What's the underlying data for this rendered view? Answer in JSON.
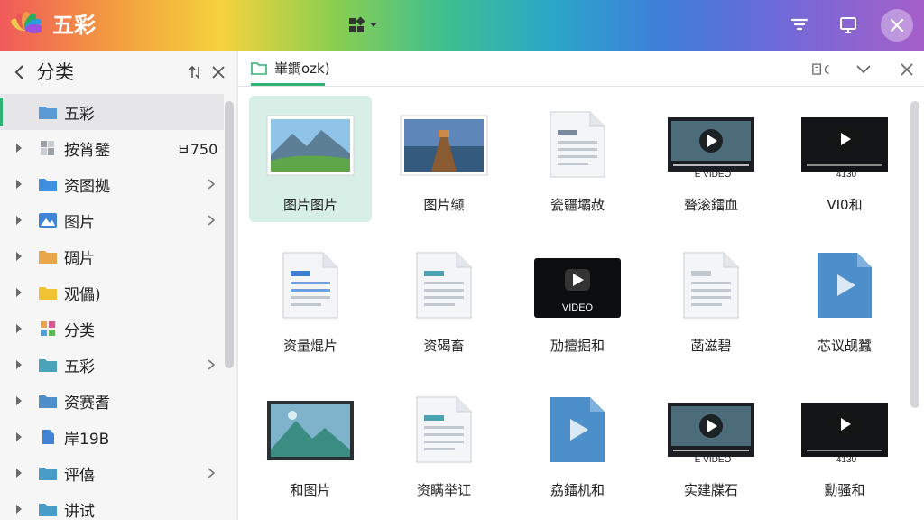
{
  "app": {
    "title": "五彩"
  },
  "sidebar": {
    "title": "分类",
    "items": [
      {
        "label": "五彩",
        "icon": "folder-icon",
        "badge": "",
        "expand": false,
        "chevron": false,
        "active": true,
        "color": "#5b9bd5"
      },
      {
        "label": "按筲鐾",
        "icon": "sheet-icon",
        "badge": "ㅂ750",
        "expand": true,
        "chevron": false,
        "active": false,
        "color": "#9aa0a8"
      },
      {
        "label": "资图拠",
        "icon": "folder-icon",
        "badge": "",
        "expand": true,
        "chevron": true,
        "active": false,
        "color": "#3e8fe0"
      },
      {
        "label": "图片",
        "icon": "image-icon",
        "badge": "",
        "expand": true,
        "chevron": true,
        "active": false,
        "color": "#3f84d6"
      },
      {
        "label": "碉片",
        "icon": "folder-icon",
        "badge": "",
        "expand": true,
        "chevron": false,
        "active": false,
        "color": "#e9a64b"
      },
      {
        "label": "观儡)",
        "icon": "folder-icon",
        "badge": "",
        "expand": true,
        "chevron": false,
        "active": false,
        "color": "#f1c232"
      },
      {
        "label": "分类",
        "icon": "apps-icon",
        "badge": "",
        "expand": true,
        "chevron": false,
        "active": false,
        "color": "#d65a8c"
      },
      {
        "label": "五彩",
        "icon": "folder-icon",
        "badge": "",
        "expand": true,
        "chevron": true,
        "active": false,
        "color": "#4aa3b8"
      },
      {
        "label": "资赛耆",
        "icon": "folder-icon",
        "badge": "",
        "expand": true,
        "chevron": false,
        "active": false,
        "color": "#4f8fc9"
      },
      {
        "label": "岸19B",
        "icon": "file-icon",
        "badge": "",
        "expand": true,
        "chevron": false,
        "active": false,
        "color": "#3f84d6"
      },
      {
        "label": "评僖",
        "icon": "folder-icon",
        "badge": "",
        "expand": true,
        "chevron": true,
        "active": false,
        "color": "#4a9cc8"
      },
      {
        "label": "讲试",
        "icon": "folder-icon",
        "badge": "",
        "expand": true,
        "chevron": false,
        "active": false,
        "color": "#4a9cc8"
      }
    ]
  },
  "tab": {
    "label": "崋鐧ozk)"
  },
  "grid": [
    {
      "label": "图片图片",
      "kind": "photo-mountain",
      "caption": "",
      "selected": true
    },
    {
      "label": "图片缬",
      "kind": "photo-pier",
      "caption": "",
      "selected": false
    },
    {
      "label": "瓷疆壩赦",
      "kind": "doc-gray",
      "caption": "",
      "selected": false
    },
    {
      "label": "聱滚鐳血",
      "kind": "video-screen",
      "caption": "E VIDEO",
      "selected": false
    },
    {
      "label": "VI0和",
      "kind": "video-dark",
      "caption": "4130",
      "selected": false
    },
    {
      "label": "资量焜片",
      "kind": "doc-blue",
      "caption": "",
      "selected": false
    },
    {
      "label": "资碣畜",
      "kind": "doc-teal",
      "caption": "",
      "selected": false
    },
    {
      "label": "劢擅掘和",
      "kind": "video-black",
      "caption": "VIDEO",
      "selected": false
    },
    {
      "label": "菡滋碧",
      "kind": "doc-plain",
      "caption": "",
      "selected": false
    },
    {
      "label": "芯议觇蠶",
      "kind": "media-blue",
      "caption": "",
      "selected": false
    },
    {
      "label": "和图片",
      "kind": "image-landscape",
      "caption": "",
      "selected": false
    },
    {
      "label": "资瞒举讧",
      "kind": "doc-teal2",
      "caption": "",
      "selected": false
    },
    {
      "label": "劦鐳机和",
      "kind": "media-blue2",
      "caption": "",
      "selected": false
    },
    {
      "label": "实建牒石",
      "kind": "video-screen2",
      "caption": "E VIDEO",
      "selected": false
    },
    {
      "label": "勳骚和",
      "kind": "video-dark2",
      "caption": "4130",
      "selected": false
    }
  ],
  "colors": {
    "accent": "#2fb374",
    "selection": "#d8efe8"
  }
}
